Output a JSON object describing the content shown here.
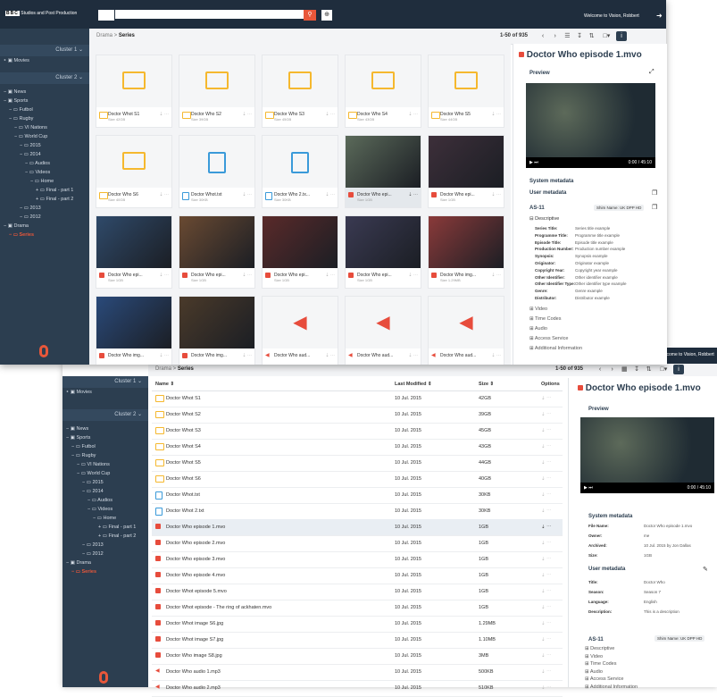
{
  "app": {
    "logo_text": "BBC",
    "production": "Studios and Post Production",
    "welcome": "Welcome to Vision, Robbert"
  },
  "toolbar": {
    "pagination": "1-50 of 935",
    "search_placeholder": ""
  },
  "breadcrumb": [
    "Drama",
    "Series"
  ],
  "sidebar": {
    "cluster1": "Cluster 1",
    "cluster2": "Cluster 2",
    "movies": "Movies",
    "tree": [
      {
        "label": "News",
        "indent": 0,
        "icon": "box"
      },
      {
        "label": "Sports",
        "indent": 0,
        "icon": "box"
      },
      {
        "label": "Futbol",
        "indent": 1,
        "icon": "folder"
      },
      {
        "label": "Rugby",
        "indent": 1,
        "icon": "folder"
      },
      {
        "label": "VI Nations",
        "indent": 2,
        "icon": "folder"
      },
      {
        "label": "World Cup",
        "indent": 2,
        "icon": "folder"
      },
      {
        "label": "2015",
        "indent": 3,
        "icon": "folder"
      },
      {
        "label": "2014",
        "indent": 3,
        "icon": "folder"
      },
      {
        "label": "Audios",
        "indent": 4,
        "icon": "folder"
      },
      {
        "label": "Videos",
        "indent": 4,
        "icon": "folder"
      },
      {
        "label": "Home",
        "indent": 5,
        "icon": "folder"
      },
      {
        "label": "Final - part 1",
        "indent": 6,
        "icon": "folder"
      },
      {
        "label": "Final - part 2",
        "indent": 6,
        "icon": "folder"
      },
      {
        "label": "2013",
        "indent": 3,
        "icon": "folder"
      },
      {
        "label": "2012",
        "indent": 3,
        "icon": "folder"
      },
      {
        "label": "Drama",
        "indent": 0,
        "icon": "box"
      },
      {
        "label": "Series",
        "indent": 1,
        "icon": "folder",
        "active": true
      }
    ]
  },
  "grid_items": [
    {
      "name": "Doctor Whot S1",
      "size": "Size 42GB",
      "type": "folder"
    },
    {
      "name": "Doctor Who S2",
      "size": "Size 39GB",
      "type": "folder"
    },
    {
      "name": "Doctor Who S3",
      "size": "Size 45GB",
      "type": "folder"
    },
    {
      "name": "Doctor Who S4",
      "size": "Size 43GB",
      "type": "folder"
    },
    {
      "name": "Doctor Who S5",
      "size": "Size 44GB",
      "type": "folder"
    },
    {
      "name": "Doctor Who S6",
      "size": "Size 40GB",
      "type": "folder"
    },
    {
      "name": "Doctor Whot.txt",
      "size": "Size 30KB",
      "type": "file"
    },
    {
      "name": "Doctor Who 2.tx...",
      "size": "Size 30KB",
      "type": "file"
    },
    {
      "name": "Doctor Who epi...",
      "size": "Size 1GB",
      "type": "video",
      "thumb": "#5b6a5a",
      "sel": true
    },
    {
      "name": "Doctor Who epi...",
      "size": "Size 1GB",
      "type": "video",
      "thumb": "#3d2f3a"
    },
    {
      "name": "Doctor Who epi...",
      "size": "Size 1GB",
      "type": "video",
      "thumb": "#2f4a6a"
    },
    {
      "name": "Doctor Who epi...",
      "size": "Size 1GB",
      "type": "video",
      "thumb": "#6a4a32"
    },
    {
      "name": "Doctor Who epi...",
      "size": "Size 1GB",
      "type": "video",
      "thumb": "#5a2a2a"
    },
    {
      "name": "Doctor Who epi...",
      "size": "Size 1GB",
      "type": "video",
      "thumb": "#3a3a52"
    },
    {
      "name": "Doctor Who img...",
      "size": "Size 1.29MB",
      "type": "image",
      "thumb": "#8a3a3a"
    },
    {
      "name": "Doctor Who img...",
      "size": "",
      "type": "image",
      "thumb": "#2a4a7a"
    },
    {
      "name": "Doctor Who img...",
      "size": "",
      "type": "image",
      "thumb": "#4a3a2a"
    },
    {
      "name": "Doctor Who aud...",
      "size": "",
      "type": "audio"
    },
    {
      "name": "Doctor Who aud...",
      "size": "",
      "type": "audio"
    },
    {
      "name": "Doctor Who aud...",
      "size": "",
      "type": "audio"
    }
  ],
  "list": {
    "headers": {
      "name": "Name",
      "modified": "Last Modified",
      "size": "Size",
      "options": "Options"
    },
    "rows": [
      {
        "name": "Doctor Whot S1",
        "date": "10 Jul. 2015",
        "size": "42GB",
        "type": "folder"
      },
      {
        "name": "Doctor Whot S2",
        "date": "10 Jul. 2015",
        "size": "39GB",
        "type": "folder"
      },
      {
        "name": "Doctor Whot S3",
        "date": "10 Jul. 2015",
        "size": "45GB",
        "type": "folder"
      },
      {
        "name": "Doctor Whot S4",
        "date": "10 Jul. 2015",
        "size": "43GB",
        "type": "folder"
      },
      {
        "name": "Doctor Whot S5",
        "date": "10 Jul. 2015",
        "size": "44GB",
        "type": "folder"
      },
      {
        "name": "Doctor Whot S6",
        "date": "10 Jul. 2015",
        "size": "40GB",
        "type": "folder"
      },
      {
        "name": "Doctor Whot.txt",
        "date": "10 Jul. 2015",
        "size": "30KB",
        "type": "file"
      },
      {
        "name": "Doctor Whot 2.txt",
        "date": "10 Jul. 2015",
        "size": "30KB",
        "type": "file"
      },
      {
        "name": "Doctor Who episode 1.mvo",
        "date": "10 Jul. 2015",
        "size": "1GB",
        "type": "video",
        "sel": true
      },
      {
        "name": "Doctor Who episode 2.mvo",
        "date": "10 Jul. 2015",
        "size": "1GB",
        "type": "video"
      },
      {
        "name": "Doctor Who episode 3.mvo",
        "date": "10 Jul. 2015",
        "size": "1GB",
        "type": "video"
      },
      {
        "name": "Doctor Who episode 4.mvo",
        "date": "10 Jul. 2015",
        "size": "1GB",
        "type": "video"
      },
      {
        "name": "Doctor Whot episode 5.mvo",
        "date": "10 Jul. 2015",
        "size": "1GB",
        "type": "video"
      },
      {
        "name": "Doctor Whot episode - The ring of ackhaten.mvo",
        "date": "10 Jul. 2015",
        "size": "1GB",
        "type": "video"
      },
      {
        "name": "Doctor Whot image S6.jpg",
        "date": "10 Jul. 2015",
        "size": "1.29MB",
        "type": "image"
      },
      {
        "name": "Doctor Whot image S7.jpg",
        "date": "10 Jul. 2015",
        "size": "1.10MB",
        "type": "image"
      },
      {
        "name": "Doctor Who image S8.jpg",
        "date": "10 Jul. 2015",
        "size": "3MB",
        "type": "image"
      },
      {
        "name": "Doctor Who audio 1.mp3",
        "date": "10 Jul. 2015",
        "size": "500KB",
        "type": "audio"
      },
      {
        "name": "Doctor Who audio 2.mp3",
        "date": "10 Jul. 2015",
        "size": "510KB",
        "type": "audio"
      }
    ]
  },
  "details": {
    "title": "Doctor Who episode 1.mvo",
    "preview_label": "Preview",
    "timecode": "0:00 / 45:10",
    "system_metadata_label": "System metadata",
    "user_metadata_label": "User metadata",
    "as11_label": "AS-11",
    "shim_label": "Shim Name: UK DPP HD",
    "descriptive_label": "Descriptive",
    "descriptive_fields": [
      {
        "k": "Series Title:",
        "v": "Series title example"
      },
      {
        "k": "Programme Title:",
        "v": "Programme title example"
      },
      {
        "k": "Episode Title:",
        "v": "Episode title example"
      },
      {
        "k": "Production Number:",
        "v": "Production number example"
      },
      {
        "k": "Synopsis:",
        "v": "Synopsis example"
      },
      {
        "k": "Originator:",
        "v": "Originator example"
      },
      {
        "k": "Copyright Year:",
        "v": "Copyright year example"
      },
      {
        "k": "Other Identifier:",
        "v": "Other identifier example"
      },
      {
        "k": "Other Identifier Type:",
        "v": "Other identifier type example"
      },
      {
        "k": "Genre:",
        "v": "Genre example"
      },
      {
        "k": "Distributor:",
        "v": "Distributor example"
      }
    ],
    "as11_sections": [
      "Video",
      "Time Codes",
      "Audio",
      "Access Service",
      "Additional Information"
    ],
    "system_fields": [
      {
        "k": "File Name:",
        "v": "Doctor Who episode 1.mvo"
      },
      {
        "k": "Owner:",
        "v": "me"
      },
      {
        "k": "Archived:",
        "v": "10 Jul. 2015 by Jon Dallas"
      },
      {
        "k": "Size:",
        "v": "1GB"
      }
    ],
    "user_fields": [
      {
        "k": "Title:",
        "v": "Doctor Who"
      },
      {
        "k": "Season:",
        "v": "Season 7"
      },
      {
        "k": "Language:",
        "v": "English"
      },
      {
        "k": "Description:",
        "v": "This is a description"
      }
    ],
    "as11_sections_back": [
      "Descriptive",
      "Video",
      "Time Codes",
      "Audio",
      "Access Service",
      "Additional Information"
    ]
  },
  "colors": {
    "accent": "#e8573a",
    "navy": "#2c3e50",
    "folder": "#f5b82e",
    "file": "#3a9ad9"
  }
}
